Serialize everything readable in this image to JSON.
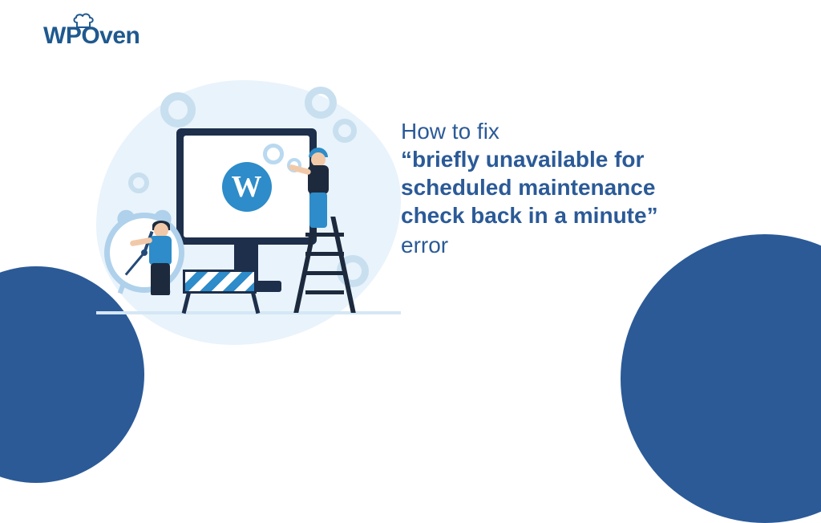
{
  "brand": {
    "name_part1": "WP",
    "name_part2": "O",
    "name_part3": "ven",
    "color": "#1f598f"
  },
  "headline": {
    "line1": "How to fix",
    "line2": "“briefly unavailable for",
    "line3": "scheduled maintenance",
    "line4": "check back in a minute”",
    "line5": "error"
  },
  "illustration": {
    "monitor_logo_label": "W",
    "icons": {
      "wordpress": "wordpress-icon",
      "gear": "gear-icon",
      "clock": "clock-icon",
      "barrier": "barrier-icon",
      "ladder": "ladder-icon"
    }
  },
  "colors": {
    "accent": "#2b5a97",
    "light_bg_blob": "#e9f3fb",
    "gear": "#c8dfef",
    "wp_blue": "#2d8cc9",
    "dark": "#1d2f4b"
  }
}
